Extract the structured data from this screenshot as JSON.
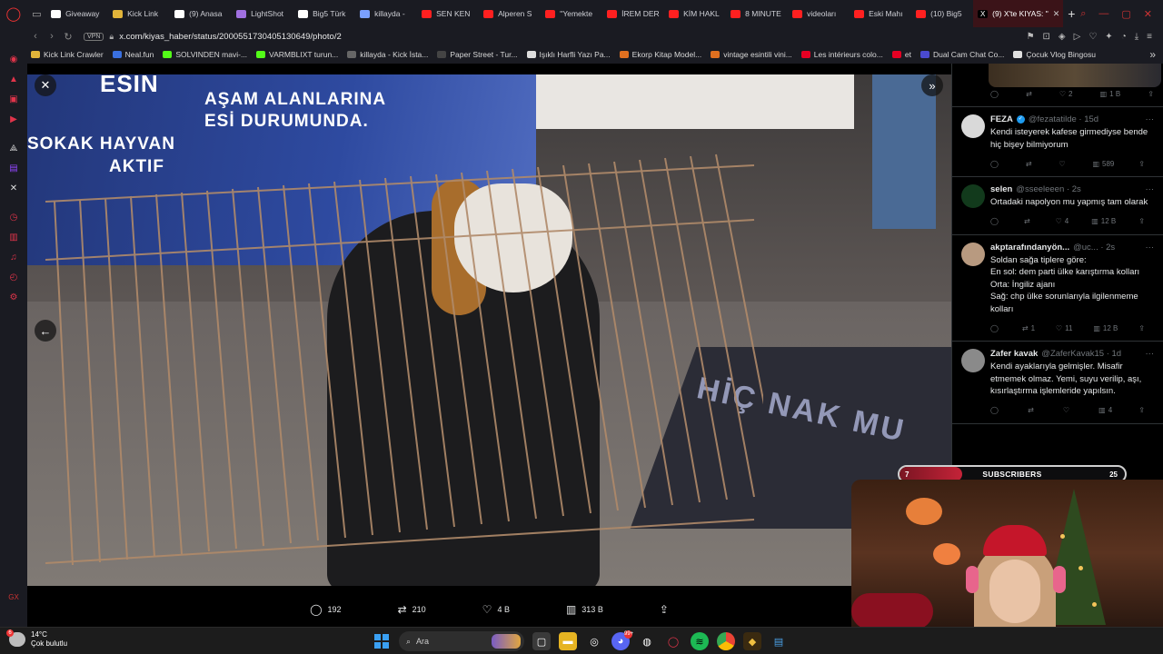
{
  "tabs": [
    {
      "label": "Giveaway",
      "color": "#ffffff"
    },
    {
      "label": "Kick Link",
      "color": "#e1b43a"
    },
    {
      "label": "(9) Anasa",
      "color": "#ffffff"
    },
    {
      "label": "LightShot",
      "color": "#a070e0"
    },
    {
      "label": "Big5 Türk",
      "color": "#ffffff"
    },
    {
      "label": "killayda -",
      "color": "#7aa0ff"
    },
    {
      "label": "SEN KEN",
      "color": "#ff2020"
    },
    {
      "label": "Alperen S",
      "color": "#ff2020"
    },
    {
      "label": "''Yemekte",
      "color": "#ff2020"
    },
    {
      "label": "İREM DER",
      "color": "#ff2020"
    },
    {
      "label": "KİM HAKL",
      "color": "#ff2020"
    },
    {
      "label": "8 MINUTE",
      "color": "#ff2020"
    },
    {
      "label": "videoları",
      "color": "#ff2020"
    },
    {
      "label": "Eski Mahı",
      "color": "#ff2020"
    },
    {
      "label": "(10) Big5",
      "color": "#ff2020"
    }
  ],
  "active_tab": {
    "label": "(9) X'te KIYAS: \"",
    "close": "✕"
  },
  "new_tab": "+",
  "address": {
    "vpn": "VPN",
    "url": "x.com/kiyas_haber/status/2000551730405130649/photo/2"
  },
  "bookmarks": [
    {
      "label": "Kick Link Crawler",
      "color": "#e1b43a"
    },
    {
      "label": "Neal.fun",
      "color": "#3a70e0"
    },
    {
      "label": "SOLVINDEN mavi-...",
      "color": "#53fc18"
    },
    {
      "label": "VARMBLIXT turun...",
      "color": "#53fc18"
    },
    {
      "label": "killayda - Kick İsta...",
      "color": "#666666"
    },
    {
      "label": "Paper Street - Tur...",
      "color": "#444444"
    },
    {
      "label": "Işıklı Harfli Yazı Pa...",
      "color": "#dddddd"
    },
    {
      "label": "Ekorp Kitap Model...",
      "color": "#e07020"
    },
    {
      "label": "vintage esintili vini...",
      "color": "#e07020"
    },
    {
      "label": "Les intérieurs colo...",
      "color": "#e60023"
    },
    {
      "label": "et",
      "color": "#e60023"
    },
    {
      "label": "Dual Cam Chat Co...",
      "color": "#4a4ad0"
    },
    {
      "label": "Çocuk Vlog Bingosu",
      "color": "#e0e0e0"
    }
  ],
  "photo": {
    "banner_lines": [
      "ESİN",
      "AŞAM ALANLARINA",
      "ESİ DURUMUNDA.",
      "SOKAK HAYVAN",
      "AKTIF"
    ],
    "mat_text": "HİÇ NAK MU"
  },
  "actions": {
    "replies": "192",
    "reposts": "210",
    "likes": "4 B",
    "views": "313 B"
  },
  "replies": [
    {
      "name": "FEZA",
      "verified": true,
      "handle": "@fezatatilde · 15d",
      "text": "Kendi isteyerek kafese girmediyse bende hiç bişey bilmiyorum",
      "reply_count": "",
      "repost_count": "",
      "like_count": "",
      "views": "589",
      "avatar_color": "#d9d9d9"
    },
    {
      "name": "selen",
      "verified": false,
      "handle": "@sseeleeen · 2s",
      "text": "Ortadaki napolyon mu yapmış tam olarak",
      "reply_count": "",
      "repost_count": "",
      "like_count": "4",
      "views": "12 B",
      "avatar_color": "#123a1c"
    },
    {
      "name": "akptarafındanyön...",
      "verified": false,
      "handle": "@uc... · 2s",
      "text": "Soldan sağa tiplere göre:\nEn sol: dem parti ülke karıştırma kolları\nOrta: İngiliz ajanı\nSağ: chp ülke sorunlarıyla ilgilenmeme kolları",
      "reply_count": "",
      "repost_count": "1",
      "like_count": "11",
      "views": "12 B",
      "avatar_color": "#b89a80"
    },
    {
      "name": "Zafer kavak",
      "verified": false,
      "handle": "@ZaferKavak15 · 1d",
      "text": "Kendi ayaklarıyla gelmişler. Misafir etmemek olmaz. Yemi, suyu verilip, aşı, kısırlaştırma işlemleride yapılsın.",
      "reply_count": "",
      "repost_count": "",
      "like_count": "",
      "views": "4",
      "avatar_color": "#8a8a8a"
    }
  ],
  "top_stats": {
    "like_count": "2",
    "views": "1 B"
  },
  "overlay": {
    "current": "7",
    "label": "SUBSCRIBERS",
    "goal": "25",
    "progress": 0.28
  },
  "taskbar": {
    "temp": "14°C",
    "condition": "Çok bulutlu",
    "search": "Ara",
    "badge": "6",
    "discord_badge": "99+"
  },
  "colors": {
    "accent": "#e0344a",
    "x_blue": "#1d9bf0",
    "bg": "#000000"
  }
}
